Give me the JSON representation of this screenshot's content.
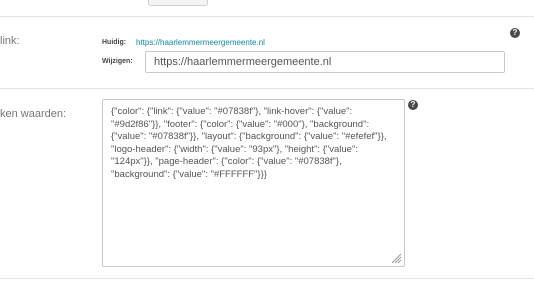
{
  "link_section": {
    "label": "link:",
    "current_label": "Huidig:",
    "current_value": "https://haarlemmermeergemeente.nl",
    "edit_label": "Wijzigen:",
    "edit_value": "https://haarlemmermeergemeente.nl",
    "help_icon": "question-circle-icon"
  },
  "values_section": {
    "label": "ken waarden:",
    "json_value": "{\"color\": {\"link\": {\"value\": \"#07838f\"}, \"link-hover\": {\"value\": \"#9d2f86\"}}, \"footer\": {\"color\": {\"value\": \"#000\"}, \"background\": {\"value\": \"#07838f\"}}, \"layout\": {\"background\": {\"value\": \"#efefef\"}}, \"logo-header\": {\"width\": {\"value\": \"93px\"}, \"height\": {\"value\": \"124px\"}}, \"page-header\": {\"color\": {\"value\": \"#07838f\"}, \"background\": {\"value\": \"#FFFFFF\"}}}",
    "help_icon": "question-circle-icon"
  },
  "colors": {
    "link": "#0a8aa8",
    "divider": "#e3e3e3",
    "icon": "#4a4a4a"
  }
}
